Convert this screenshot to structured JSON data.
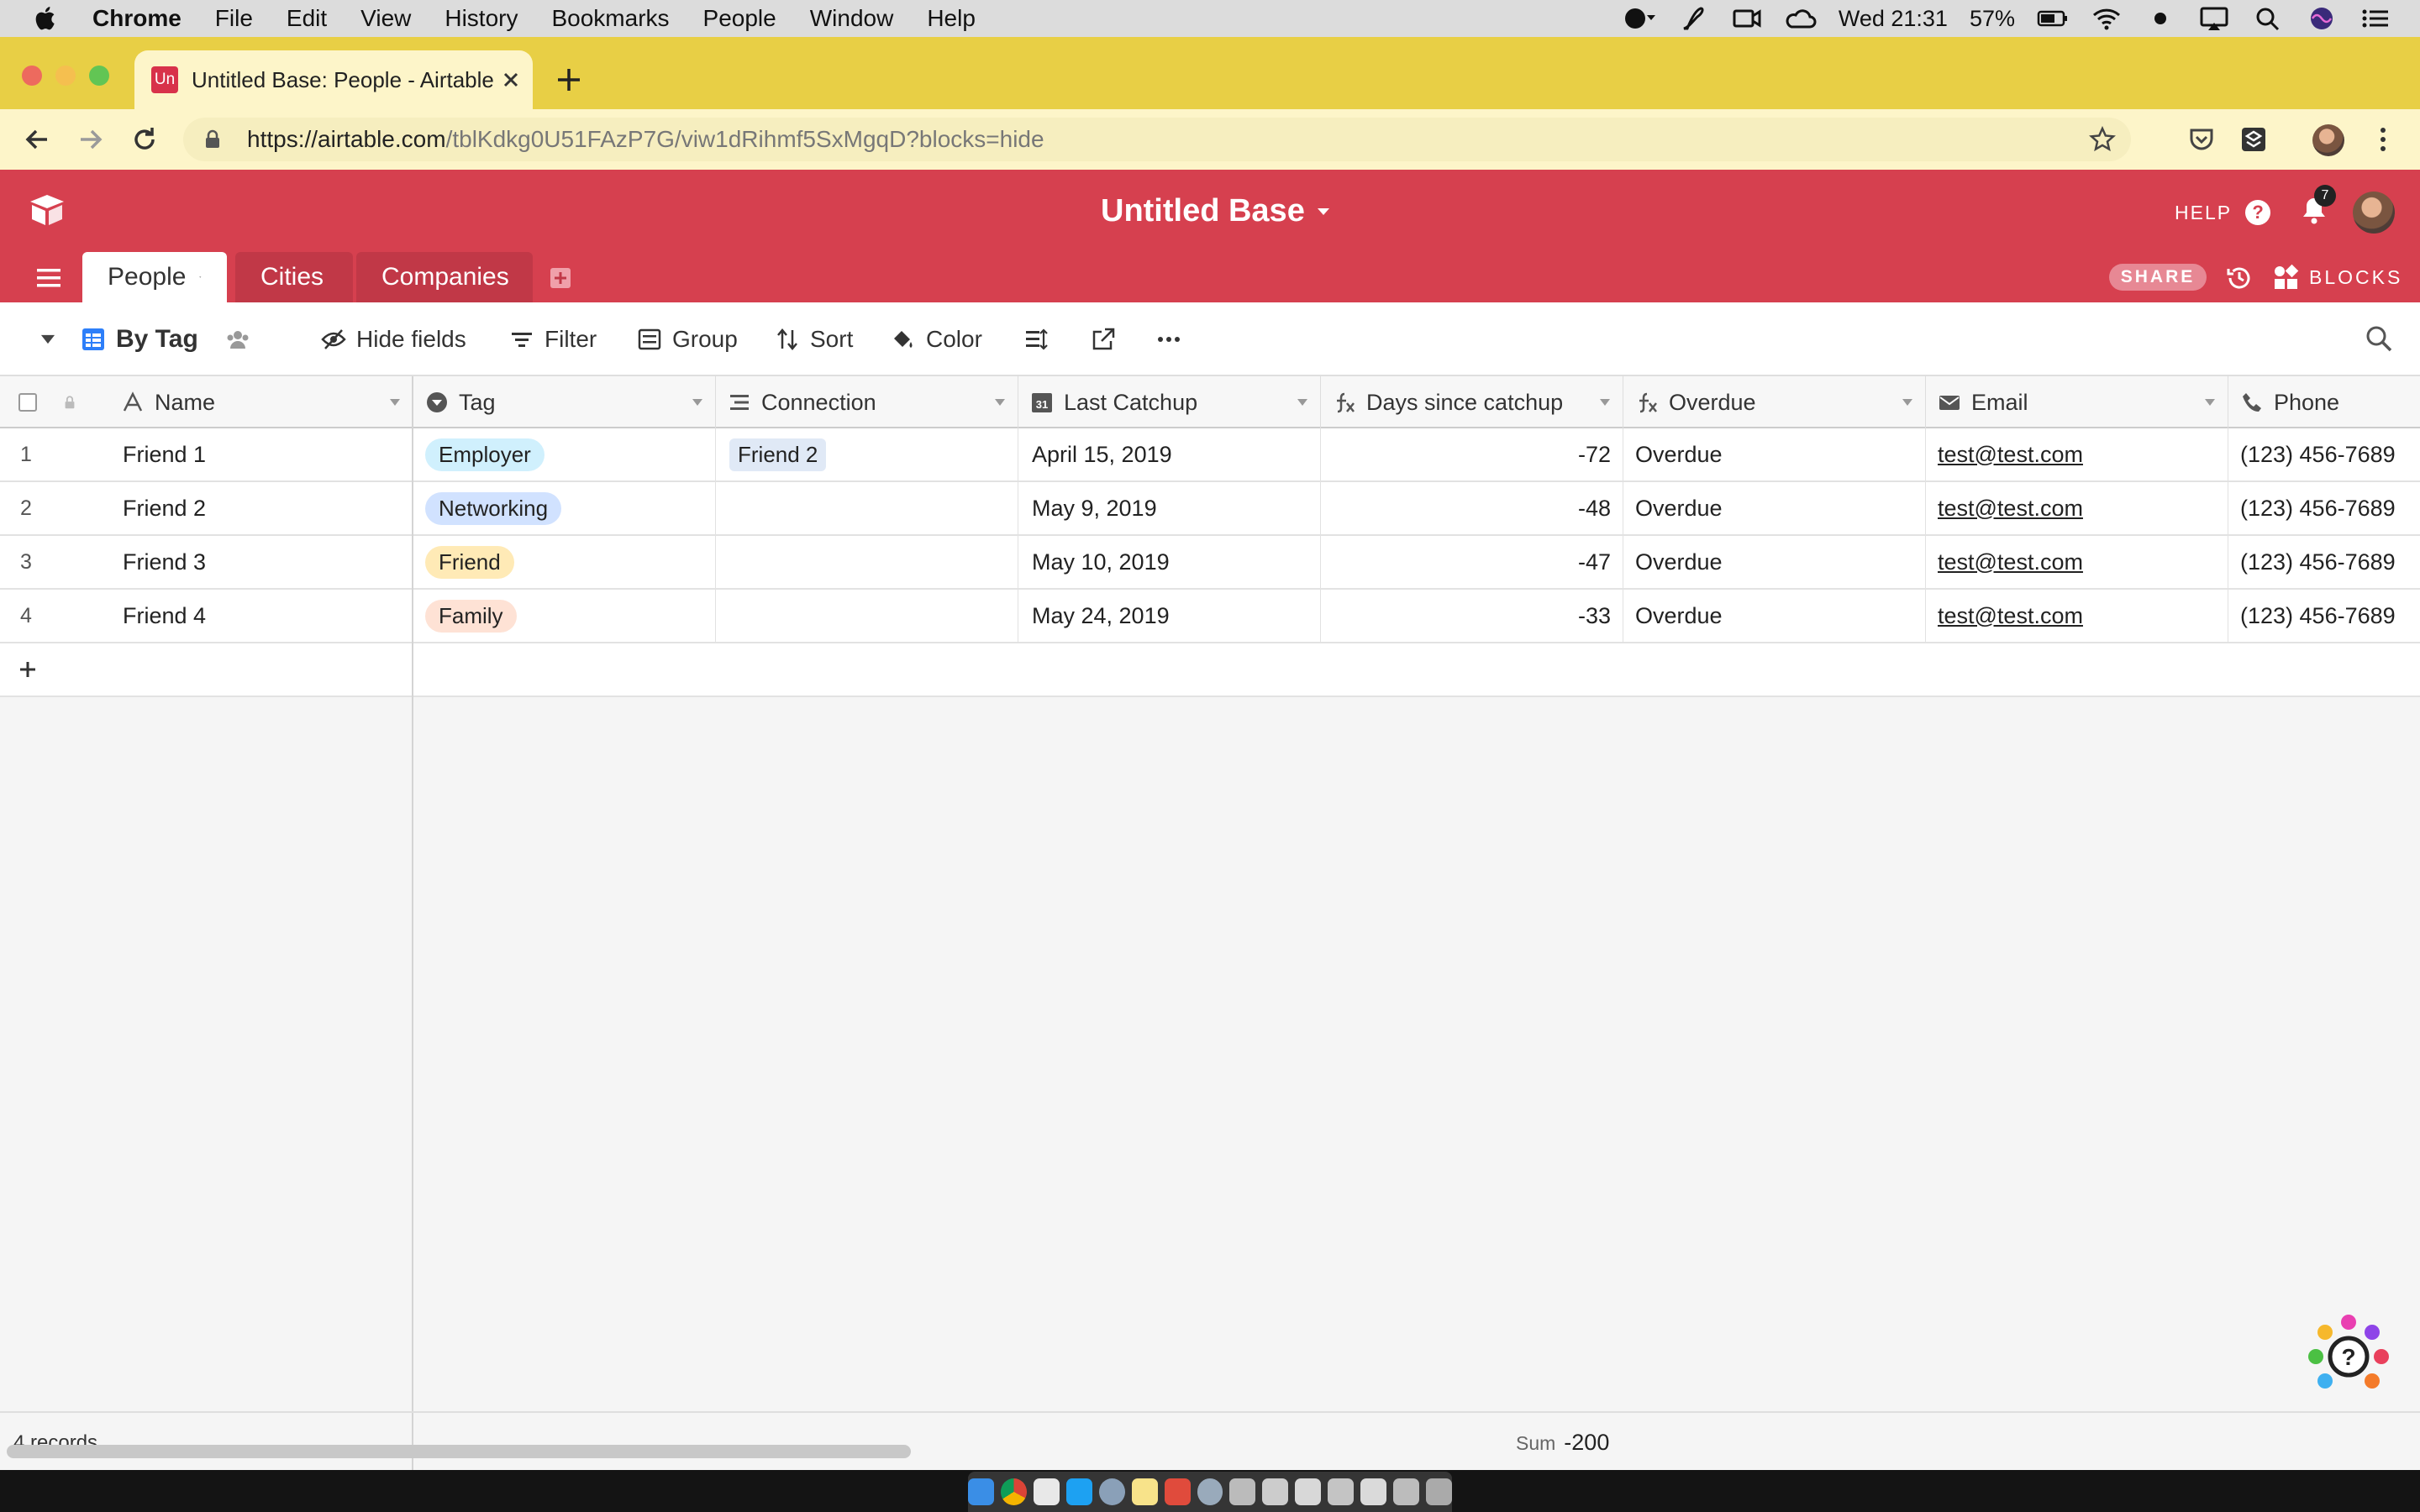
{
  "menubar": {
    "app_name": "Chrome",
    "items": [
      "File",
      "Edit",
      "View",
      "History",
      "Bookmarks",
      "People",
      "Window",
      "Help"
    ],
    "clock": "Wed 21:31",
    "battery": "57%"
  },
  "browser": {
    "tab_title": "Untitled Base: People - Airtable",
    "favicon_text": "Un",
    "url_host": "https://airtable.com",
    "url_path": "/tblKdkg0U51FAzP7G/viw1dRihmf5SxMgqD?blocks=hide"
  },
  "header": {
    "base_title": "Untitled Base",
    "help_label": "HELP",
    "notification_count": "7",
    "share_label": "SHARE",
    "blocks_label": "BLOCKS",
    "accent": "#d6404f"
  },
  "tables": [
    {
      "label": "People",
      "active": true
    },
    {
      "label": "Cities",
      "active": false
    },
    {
      "label": "Companies",
      "active": false
    }
  ],
  "viewbar": {
    "view_name": "By Tag",
    "hide_fields": "Hide fields",
    "filter": "Filter",
    "group": "Group",
    "sort": "Sort",
    "color": "Color"
  },
  "grid": {
    "columns": [
      "Name",
      "Tag",
      "Connection",
      "Last Catchup",
      "Days since catchup",
      "Overdue",
      "Email",
      "Phone"
    ],
    "rows": [
      {
        "num": "1",
        "name": "Friend 1",
        "tag": "Employer",
        "tag_color": "#d0f0fd",
        "connection": "Friend 2",
        "last_catchup": "April 15, 2019",
        "days": "-72",
        "overdue": "Overdue",
        "email": "test@test.com",
        "phone": "(123) 456-7689"
      },
      {
        "num": "2",
        "name": "Friend 2",
        "tag": "Networking",
        "tag_color": "#d1e2ff",
        "connection": "",
        "last_catchup": "May 9, 2019",
        "days": "-48",
        "overdue": "Overdue",
        "email": "test@test.com",
        "phone": "(123) 456-7689"
      },
      {
        "num": "3",
        "name": "Friend 3",
        "tag": "Friend",
        "tag_color": "#ffeab6",
        "connection": "",
        "last_catchup": "May 10, 2019",
        "days": "-47",
        "overdue": "Overdue",
        "email": "test@test.com",
        "phone": "(123) 456-7689"
      },
      {
        "num": "4",
        "name": "Friend 4",
        "tag": "Family",
        "tag_color": "#fee2d5",
        "connection": "",
        "last_catchup": "May 24, 2019",
        "days": "-33",
        "overdue": "Overdue",
        "email": "test@test.com",
        "phone": "(123) 456-7689"
      }
    ]
  },
  "footer": {
    "record_count": "4 records",
    "sum_label": "Sum",
    "sum_value": "-200"
  }
}
